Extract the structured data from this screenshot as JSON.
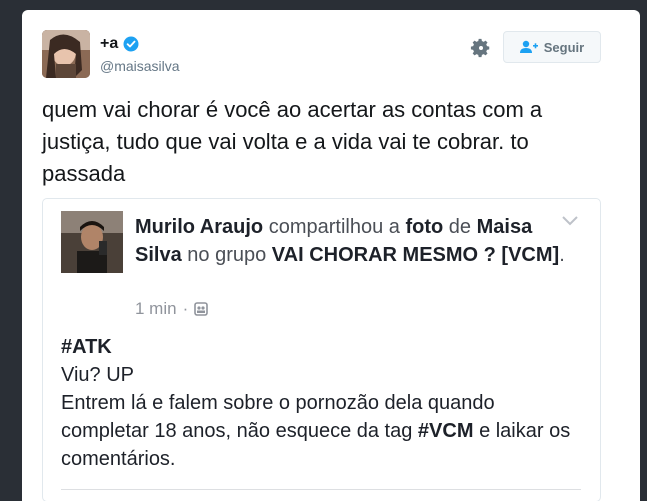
{
  "author": {
    "name": "+a",
    "handle": "@maisasilva"
  },
  "follow_button": {
    "label": "Seguir"
  },
  "tweet": {
    "text": "quem vai chorar é você ao acertar as contas com a justiça, tudo que vai volta e a vida vai te cobrar. to passada"
  },
  "embedded_post": {
    "poster": "Murilo Araujo",
    "shared_text": "compartilhou a",
    "photo_word": "foto",
    "of_word": "de",
    "original_author": "Maisa Silva",
    "in_group_text": "no grupo",
    "group_name": "VAI CHORAR MESMO ? [VCM]",
    "period": ".",
    "time": "1 min",
    "dot": "·",
    "hashtag": "#ATK",
    "line1": "Viu? UP",
    "line2_part1": "Entrem lá e falem sobre o pornozão dela quando completar 18 anos, não esquece da tag",
    "line2_tag": "#VCM",
    "line2_part2": "e laikar os comentários."
  },
  "colors": {
    "verified": "#1da1f2",
    "follow_icon": "#1da1f2",
    "text": "#14171a",
    "secondary": "#657786"
  },
  "icons": [
    "verified-badge-icon",
    "gear-icon",
    "follow-user-icon",
    "chevron-down-icon",
    "group-audience-icon"
  ]
}
